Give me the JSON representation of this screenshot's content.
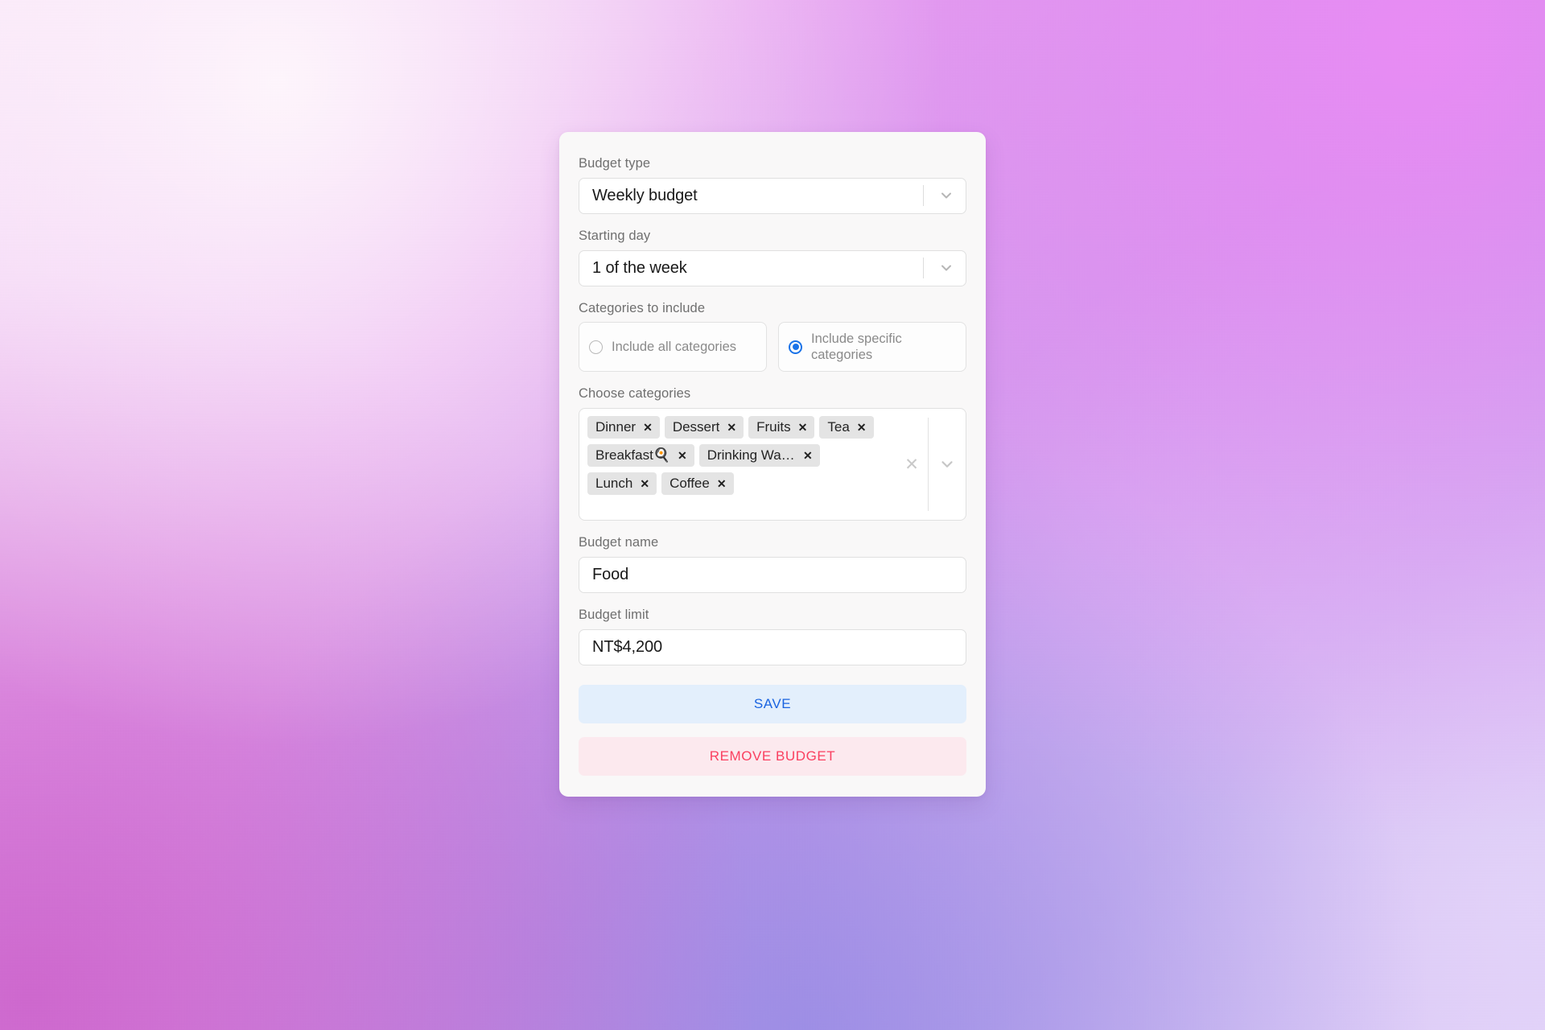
{
  "theme": {
    "accent_blue": "#1a73e8",
    "save_bg": "#e3effc",
    "save_fg": "#1a64e0",
    "remove_bg": "#fce9ee",
    "remove_fg": "#fa4060",
    "card_bg": "#f9f8f8",
    "chip_bg": "#e4e4e4"
  },
  "form": {
    "budget_type": {
      "label": "Budget type",
      "value": "Weekly budget",
      "chevron_icon": "chevron-down-icon"
    },
    "starting_day": {
      "label": "Starting day",
      "value": "1 of the week",
      "chevron_icon": "chevron-down-icon"
    },
    "categories_to_include": {
      "label": "Categories to include",
      "options": [
        {
          "label": "Include all categories",
          "selected": false
        },
        {
          "label": "Include specific categories",
          "selected": true
        }
      ]
    },
    "choose_categories": {
      "label": "Choose categories",
      "clear_icon": "close-icon",
      "chevron_icon": "chevron-down-icon",
      "chips": [
        {
          "label": "Dinner",
          "remove_icon": "close-icon"
        },
        {
          "label": "Dessert",
          "remove_icon": "close-icon"
        },
        {
          "label": "Fruits",
          "remove_icon": "close-icon"
        },
        {
          "label": "Tea",
          "remove_icon": "close-icon"
        },
        {
          "label": "Breakfast🍳",
          "remove_icon": "close-icon"
        },
        {
          "label": "Drinking Wat…",
          "remove_icon": "close-icon"
        },
        {
          "label": "Lunch",
          "remove_icon": "close-icon"
        },
        {
          "label": "Coffee",
          "remove_icon": "close-icon"
        }
      ]
    },
    "budget_name": {
      "label": "Budget name",
      "value": "Food"
    },
    "budget_limit": {
      "label": "Budget limit",
      "value": "NT$4,200"
    }
  },
  "actions": {
    "save_label": "SAVE",
    "remove_label": "REMOVE BUDGET"
  }
}
